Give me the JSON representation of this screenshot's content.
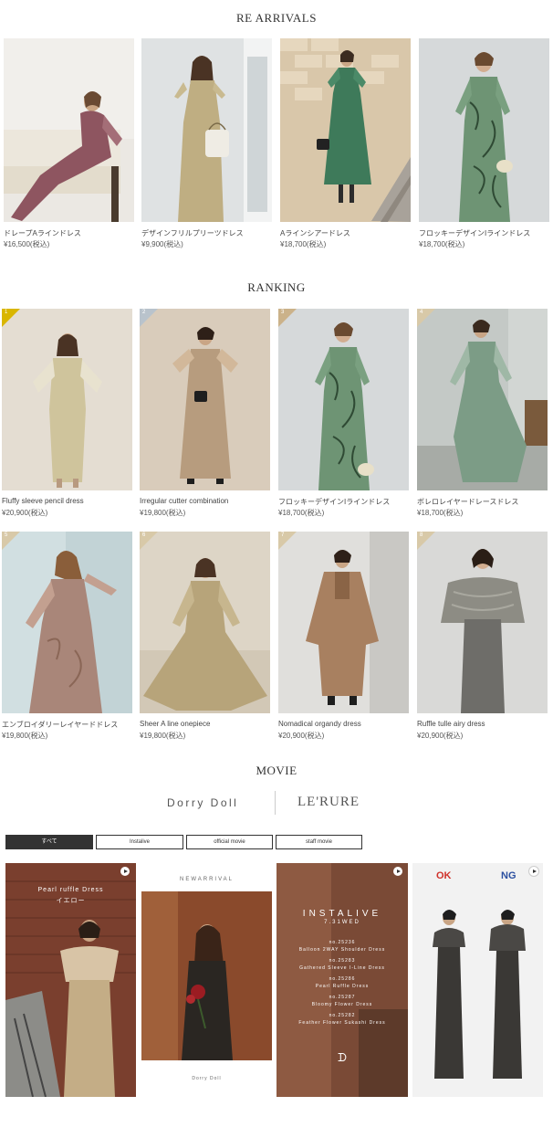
{
  "arrivals": {
    "title": "RE ARRIVALS",
    "items": [
      {
        "name": "ドレープAラインドレス",
        "price": "¥16,500(税込)"
      },
      {
        "name": "デザインフリルプリーツドレス",
        "price": "¥9,900(税込)"
      },
      {
        "name": "Aラインシアードレス",
        "price": "¥18,700(税込)"
      },
      {
        "name": "フロッキーデザインIラインドレス",
        "price": "¥18,700(税込)"
      }
    ]
  },
  "ranking": {
    "title": "RANKING",
    "items": [
      {
        "rank": "1",
        "name": "Fluffy sleeve pencil dress",
        "price": "¥20,900(税込)"
      },
      {
        "rank": "2",
        "name": "Irregular cutter combination",
        "price": "¥19,800(税込)"
      },
      {
        "rank": "3",
        "name": "フロッキーデザインIラインドレス",
        "price": "¥18,700(税込)"
      },
      {
        "rank": "4",
        "name": "ボレロレイヤードレースドレス",
        "price": "¥18,700(税込)"
      },
      {
        "rank": "5",
        "name": "エンブロイダリーレイヤードドレス",
        "price": "¥19,800(税込)"
      },
      {
        "rank": "6",
        "name": "Sheer A line onepiece",
        "price": "¥19,800(税込)"
      },
      {
        "rank": "7",
        "name": "Nomadical organdy dress",
        "price": "¥20,900(税込)"
      },
      {
        "rank": "8",
        "name": "Ruffle tulle airy dress",
        "price": "¥20,900(税込)"
      }
    ]
  },
  "movie": {
    "title": "MOVIE",
    "brand_left": "Dorry Doll",
    "brand_right": "LE'RURE",
    "tabs": [
      "すべて",
      "Instalive",
      "official movie",
      "staff movie"
    ],
    "videos": [
      {
        "caption_line1": "Pearl ruffle Dress",
        "caption_line2": "イエロー"
      },
      {
        "header": "NEWARRIVAL",
        "footer": "Dorry Doll"
      },
      {
        "title": "INSTALIVE",
        "date": "7.31WED",
        "lines": [
          "no.25236",
          "Balloon 2WAY Shoulder Dress",
          "no.25283",
          "Gathered Sleeve I-Line Dress",
          "no.25286",
          "Pearl Ruffle Dress",
          "no.25287",
          "Bloomy Flower Dress",
          "no.25282",
          "Feather Flower Sukashi Dress"
        ]
      },
      {
        "ok": "OK",
        "ng": "NG"
      }
    ]
  },
  "colors": {
    "rank_gold": "#d9b600",
    "rank_silver": "#b9c3cc",
    "rank_bronze": "#cbb28a",
    "ok_red": "#d0322b",
    "ng_blue": "#2b4fa0",
    "active_tab": "#333333"
  }
}
